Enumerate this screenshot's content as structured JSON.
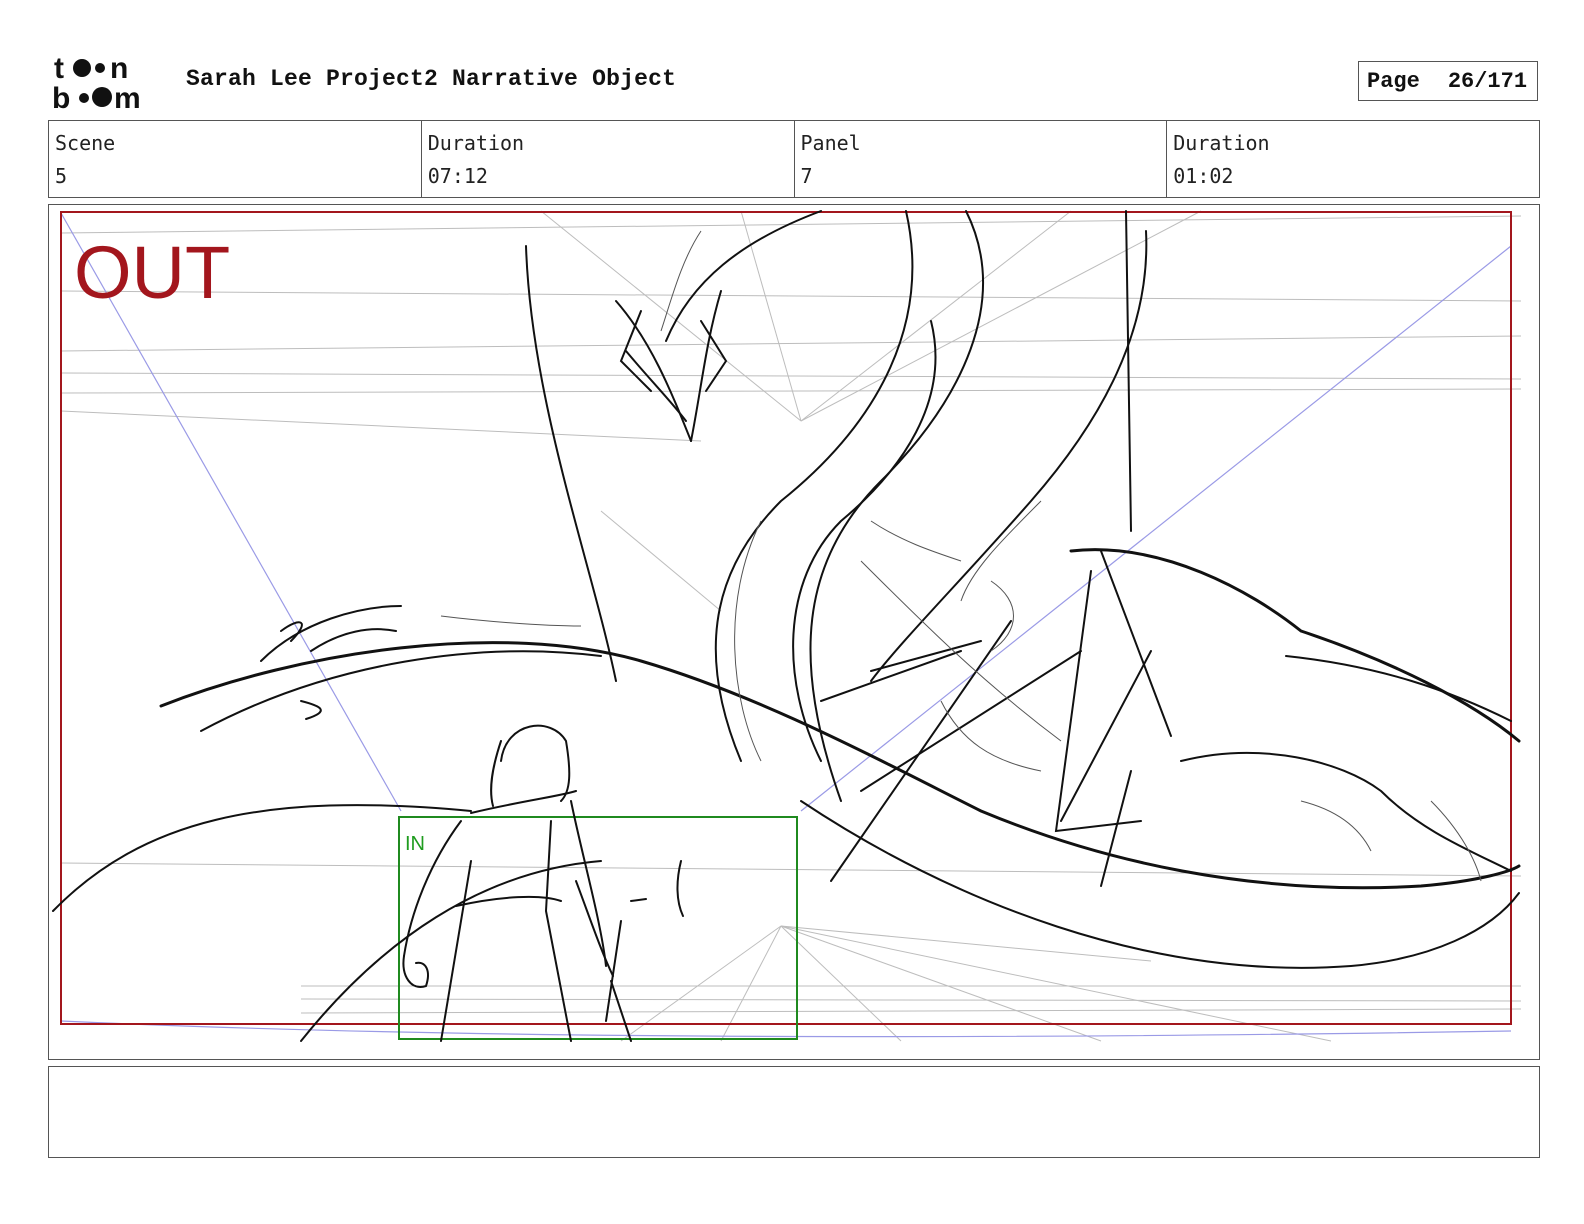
{
  "header": {
    "logo_text_top": "toon",
    "logo_text_bottom": "boom",
    "project_title": "Sarah Lee Project2 Narrative Object",
    "page_label": "Page",
    "page_number": "26/171"
  },
  "info": {
    "scene_label": "Scene",
    "scene_value": "5",
    "scene_duration_label": "Duration",
    "scene_duration_value": "07:12",
    "panel_label": "Panel",
    "panel_value": "7",
    "panel_duration_label": "Duration",
    "panel_duration_value": "01:02"
  },
  "panel": {
    "out_label": "OUT",
    "in_label": "IN",
    "out_frame_color": "#a3161d",
    "in_frame_color": "#1f8a1f",
    "guide_color": "#8c8cdc",
    "sketch_color": "#111111"
  },
  "notes": {
    "text": ""
  }
}
